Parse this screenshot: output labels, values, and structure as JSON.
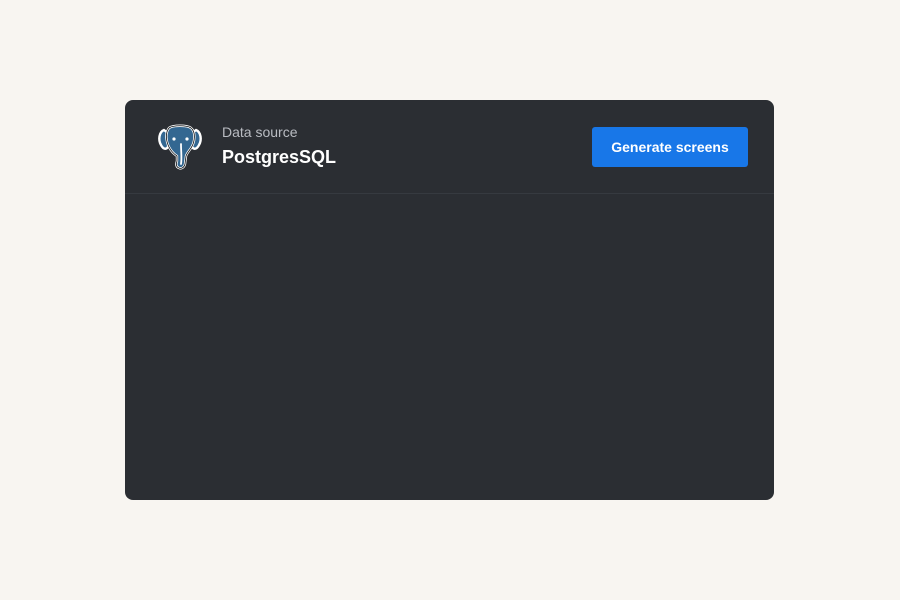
{
  "data_source": {
    "label": "Data source",
    "name": "PostgresSQL",
    "icon": "postgresql-elephant-icon"
  },
  "actions": {
    "generate_label": "Generate screens"
  },
  "colors": {
    "page_background": "#f8f5f1",
    "card_background": "#2b2e33",
    "accent": "#1877e8",
    "logo_blue": "#336791"
  }
}
